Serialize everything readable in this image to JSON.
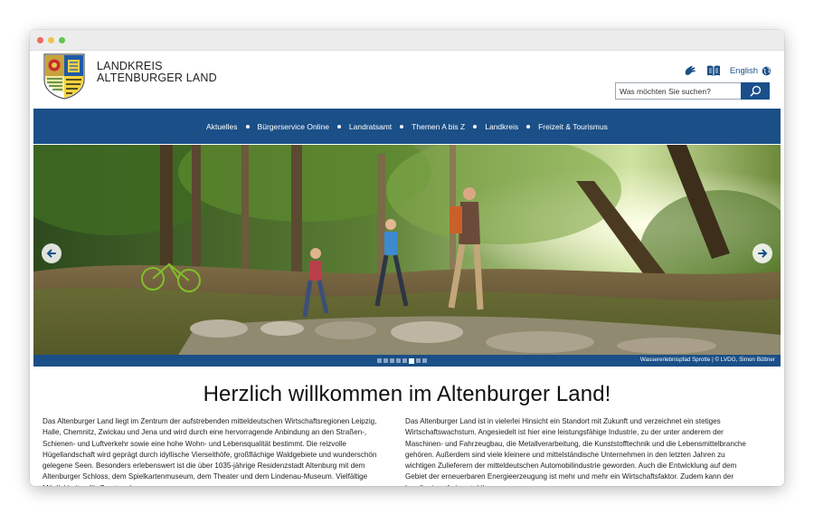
{
  "header": {
    "brand_line1": "LANDKREIS",
    "brand_line2": "ALTENBURGER LAND",
    "language_label": "English",
    "search_placeholder": "Was möchten Sie suchen?"
  },
  "nav": {
    "items": [
      {
        "label": "Aktuelles"
      },
      {
        "label": "Bürgerservice Online"
      },
      {
        "label": "Landratsamt"
      },
      {
        "label": "Themen A bis Z"
      },
      {
        "label": "Landkreis"
      },
      {
        "label": "Freizeit & Tourismus"
      }
    ]
  },
  "hero": {
    "credit": "Wassererlebnispfad Sprotte | © LVDG, Simon Büttner",
    "slide_count": 8,
    "active_slide": 5
  },
  "content": {
    "title": "Herzlich willkommen im Altenburger Land!",
    "left_text": "Das Altenburger Land liegt im Zentrum der aufstrebenden mitteldeutschen Wirtschaftsregionen Leipzig, Halle, Chemnitz, Zwickau und Jena und wird durch eine hervorragende Anbindung an den Straßen-, Schienen- und Luftverkehr sowie eine hohe Wohn- und Lebensqualität bestimmt. Die reizvolle Hügellandschaft wird geprägt durch idyllische Vierseithöfe, großflächige Waldgebiete und wunderschön gelegene Seen. Besonders erlebenswert ist die über 1035-jährige Residenzstadt Altenburg mit dem Altenburger Schloss, dem Spielkartenmuseum, dem Theater und dem Lindenau-Museum. Vielfältige Möglichkeiten für Sport und",
    "right_text": "Das Altenburger Land ist in vielerlei Hinsicht ein Standort mit Zukunft und verzeichnet ein stetiges Wirtschaftswachstum. Angesiedelt ist hier eine leistungsfähige Industrie, zu der unter anderem der Maschinen- und Fahrzeugbau, die Metallverarbeitung, die Kunststofftechnik und die Lebensmittelbranche gehören. Außerdem sind viele kleinere und mittelständische Unternehmen in den letzten Jahren zu wichtigen Zulieferern der mitteldeutschen Automobilindustrie geworden. Auch die Entwicklung auf dem Gebiet der erneuerbaren Energieerzeugung ist mehr und mehr ein Wirtschaftsfaktor. Zudem kann der Landkreis auf eine stabile"
  },
  "colors": {
    "brand_blue": "#1b4f87",
    "titlebar": "#ececec"
  }
}
